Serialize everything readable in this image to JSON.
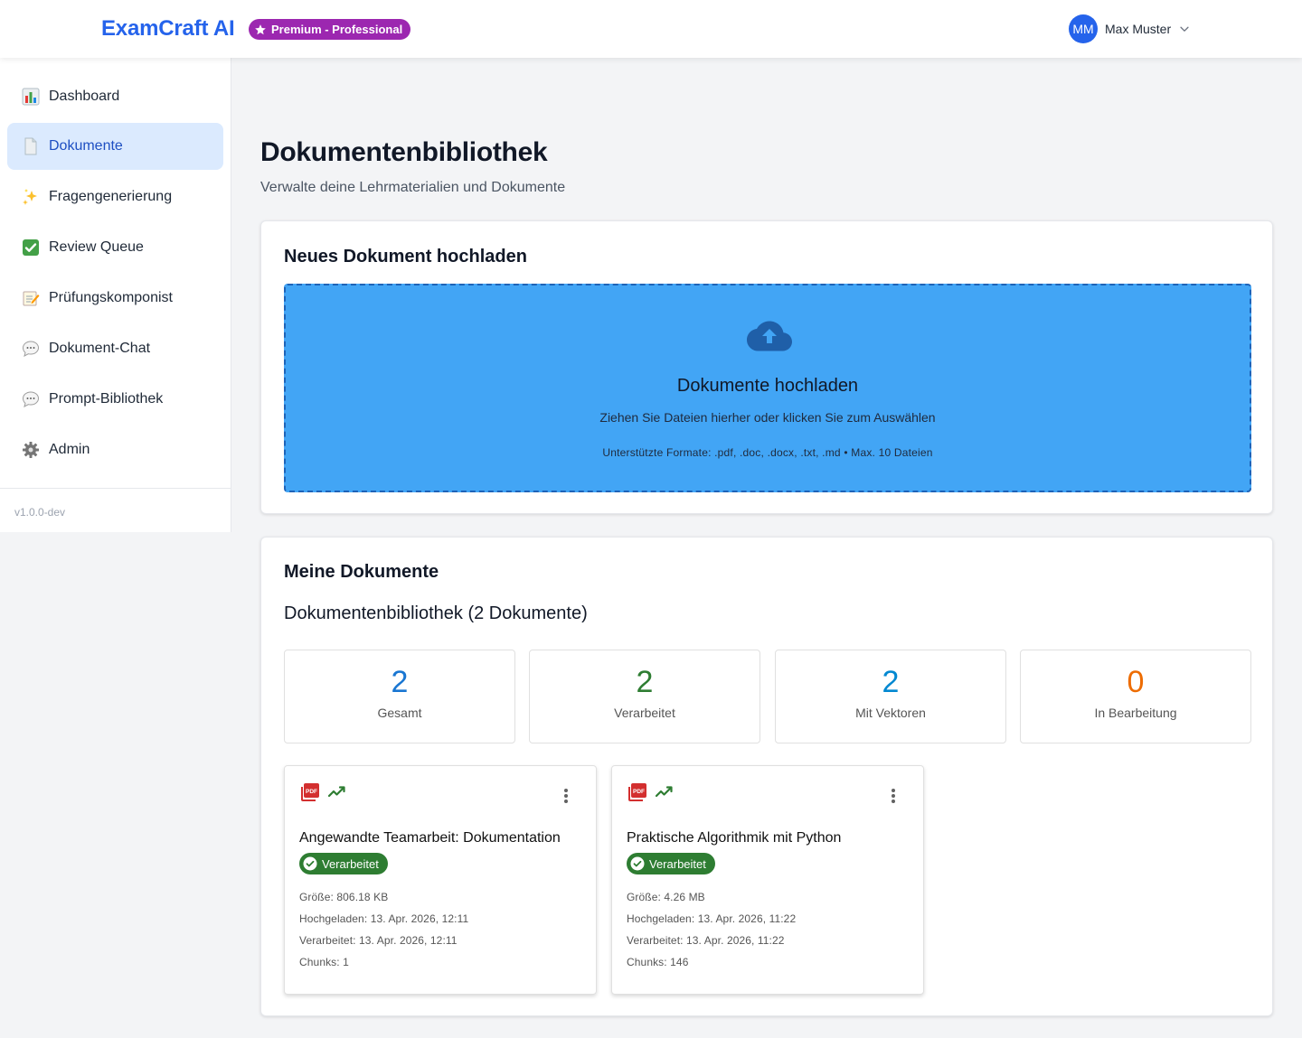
{
  "header": {
    "brand": "ExamCraft AI",
    "plan_badge": "Premium - Professional",
    "user_initials": "MM",
    "user_name": "Max Muster"
  },
  "sidebar": {
    "items": [
      {
        "label": "Dashboard",
        "icon": "bar-chart-icon",
        "active": false
      },
      {
        "label": "Dokumente",
        "icon": "document-icon",
        "active": true
      },
      {
        "label": "Fragengenerierung",
        "icon": "sparkles-icon",
        "active": false
      },
      {
        "label": "Review Queue",
        "icon": "check-box-icon",
        "active": false
      },
      {
        "label": "Prüfungskomponist",
        "icon": "memo-icon",
        "active": false
      },
      {
        "label": "Dokument-Chat",
        "icon": "speech-bubble-icon",
        "active": false
      },
      {
        "label": "Prompt-Bibliothek",
        "icon": "speech-bubble-icon",
        "active": false
      },
      {
        "label": "Admin",
        "icon": "gear-icon",
        "active": false
      }
    ],
    "version": "v1.0.0-dev"
  },
  "main": {
    "title": "Dokumentenbibliothek",
    "subtitle": "Verwalte deine Lehrmaterialien und Dokumente",
    "upload": {
      "card_title": "Neues Dokument hochladen",
      "dropzone_title": "Dokumente hochladen",
      "dropzone_subtitle": "Ziehen Sie Dateien hierher oder klicken Sie zum Auswählen",
      "formats": "Unterstützte Formate: .pdf, .doc, .docx, .txt, .md • Max. 10 Dateien"
    },
    "docs": {
      "card_title": "Meine Dokumente",
      "library_heading": "Dokumentenbibliothek (2 Dokumente)",
      "stats": [
        {
          "value": "2",
          "label": "Gesamt",
          "color": "#1976d2"
        },
        {
          "value": "2",
          "label": "Verarbeitet",
          "color": "#2e7d32"
        },
        {
          "value": "2",
          "label": "Mit Vektoren",
          "color": "#0288d1"
        },
        {
          "value": "0",
          "label": "In Bearbeitung",
          "color": "#ed6c02"
        }
      ],
      "documents": [
        {
          "title": "Angewandte Teamarbeit: Dokumentation",
          "status": "Verarbeitet",
          "size": "Größe: 806.18 KB",
          "uploaded": "Hochgeladen: 13. Apr. 2026, 12:11",
          "processed": "Verarbeitet: 13. Apr. 2026, 12:11",
          "chunks": "Chunks: 1"
        },
        {
          "title": "Praktische Algorithmik mit Python",
          "status": "Verarbeitet",
          "size": "Größe: 4.26 MB",
          "uploaded": "Hochgeladen: 13. Apr. 2026, 11:22",
          "processed": "Verarbeitet: 13. Apr. 2026, 11:22",
          "chunks": "Chunks: 146"
        }
      ]
    }
  },
  "colors": {
    "brand": "#2563eb",
    "premium": "#9c27b0",
    "dropzone": "#42a5f5",
    "success": "#2e7d32",
    "pdf": "#d32f2f"
  }
}
